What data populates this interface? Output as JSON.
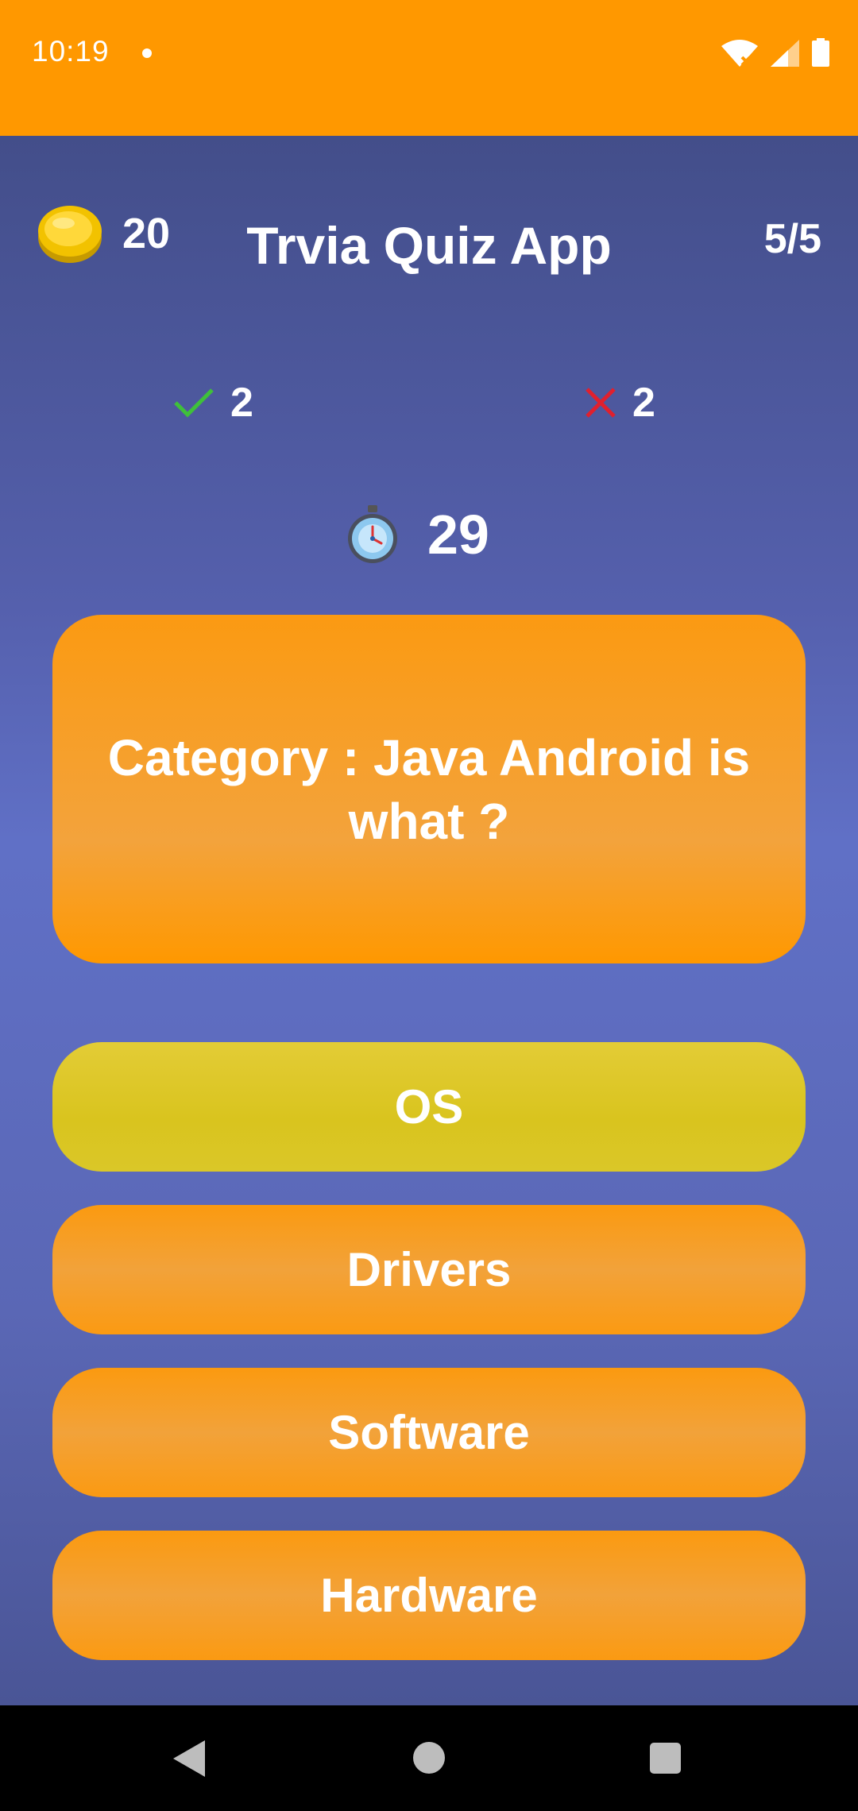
{
  "status_bar": {
    "time": "10:19",
    "icons": [
      "notification-dot-icon",
      "wifi-icon",
      "signal-icon",
      "battery-icon"
    ]
  },
  "header": {
    "coins": "20",
    "title": "Trvia Quiz App",
    "progress": "5/5"
  },
  "score": {
    "correct": "2",
    "wrong": "2"
  },
  "timer": {
    "seconds": "29"
  },
  "question": {
    "text": "Category : Java Android is what ?"
  },
  "answers": [
    {
      "label": "OS",
      "state": "selected"
    },
    {
      "label": "Drivers",
      "state": "default"
    },
    {
      "label": "Software",
      "state": "default"
    },
    {
      "label": "Hardware",
      "state": "default"
    }
  ],
  "colors": {
    "status_bar": "#FF9800",
    "answer_default": "#F7A02A",
    "answer_selected": "#DCC627",
    "correct": "#3FC03A",
    "wrong": "#E0202E"
  },
  "nav": {
    "icons": [
      "back-icon",
      "home-icon",
      "recents-icon"
    ]
  }
}
